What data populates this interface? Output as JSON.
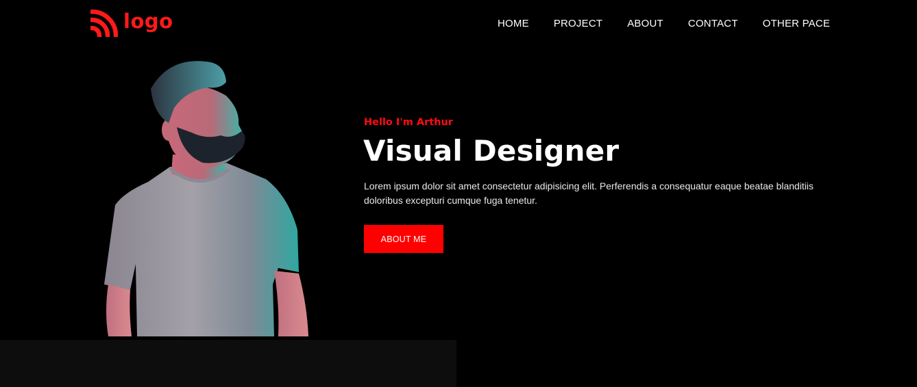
{
  "brand": {
    "logo_text": "logo",
    "accent_color": "#ff0000",
    "icon": "rss-feed-icon"
  },
  "nav": {
    "items": [
      {
        "label": "HOME"
      },
      {
        "label": "PROJECT"
      },
      {
        "label": "ABOUT"
      },
      {
        "label": "CONTACT"
      },
      {
        "label": "OTHER PACE"
      }
    ]
  },
  "hero": {
    "greeting": "Hello I'm Arthur",
    "title": "Visual Designer",
    "description": "Lorem ipsum dolor sit amet consectetur adipisicing elit. Perferendis a consequatur eaque beatae blanditiis doloribus excepturi cumque fuga tenetur.",
    "button_label": "ABOUT ME",
    "photo": "bearded-man-portrait"
  }
}
